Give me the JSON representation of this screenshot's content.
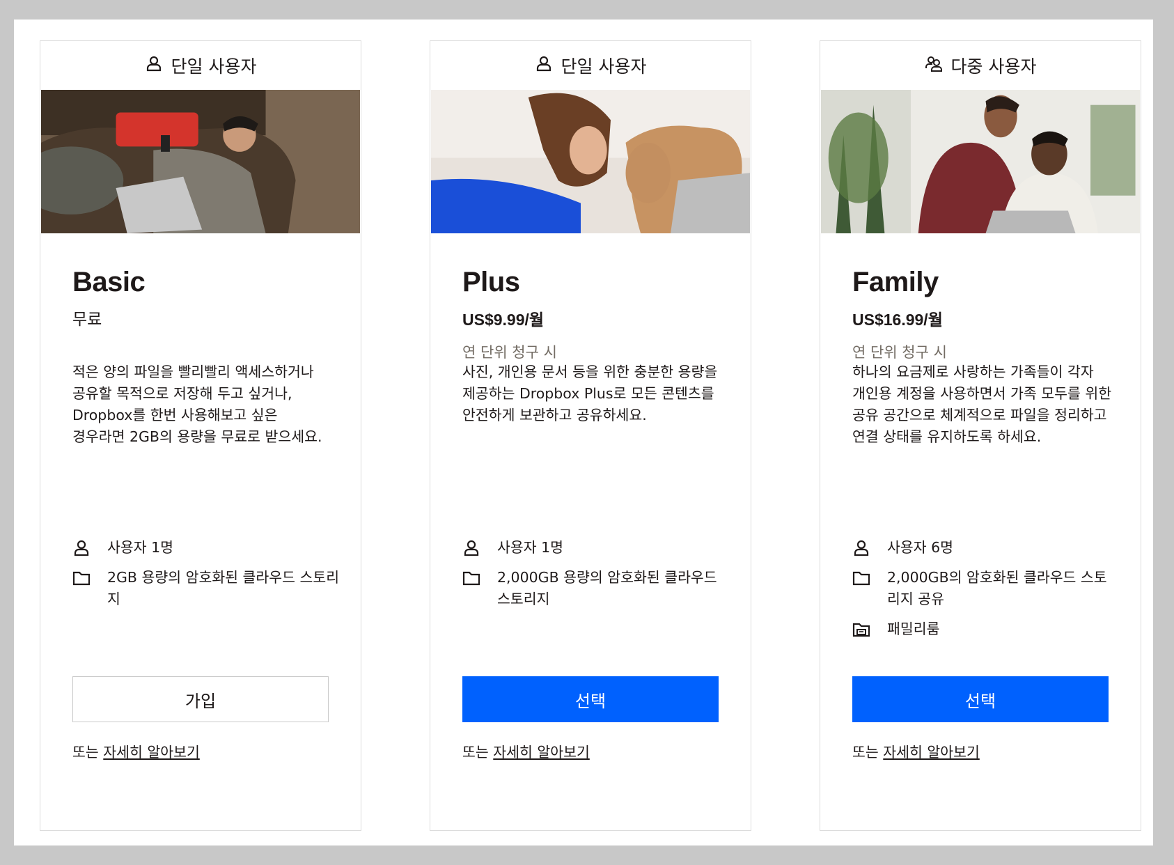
{
  "cards": [
    {
      "audience": "단일 사용자",
      "audience_icon": "single-user-icon",
      "name": "Basic",
      "price": "무료",
      "billing": "",
      "description": "적은 양의 파일을 빨리빨리 액세스하거나 공유할 목적으로 저장해 두고 싶거나, Dropbox를 한번 사용해보고 싶은 경우라면 2GB의 용량을 무료로 받으세요.",
      "features": [
        {
          "icon": "user-icon",
          "text": "사용자 1명"
        },
        {
          "icon": "folder-icon",
          "text": "2GB 용량의 암호화된 클라우드 스토리지"
        }
      ],
      "button": "가입",
      "or_text": "또는",
      "learn_more": "자세히 알아보기"
    },
    {
      "audience": "단일 사용자",
      "audience_icon": "single-user-icon",
      "name": "Plus",
      "price": "US$9.99/월",
      "billing": "연 단위 청구 시",
      "description": "사진, 개인용 문서 등을 위한 충분한 용량을 제공하는 Dropbox Plus로 모든 콘텐츠를 안전하게 보관하고 공유하세요.",
      "features": [
        {
          "icon": "user-icon",
          "text": "사용자 1명"
        },
        {
          "icon": "folder-icon",
          "text": "2,000GB 용량의 암호화된 클라우드 스토리지"
        }
      ],
      "button": "선택",
      "or_text": "또는",
      "learn_more": "자세히 알아보기"
    },
    {
      "audience": "다중 사용자",
      "audience_icon": "multi-user-icon",
      "name": "Family",
      "price": "US$16.99/월",
      "billing": "연 단위 청구 시",
      "description": "하나의 요금제로 사랑하는 가족들이 각자 개인용 계정을 사용하면서 가족 모두를 위한 공유 공간으로 체계적으로 파일을 정리하고 연결 상태를 유지하도록 하세요.",
      "features": [
        {
          "icon": "user-icon",
          "text": "사용자 6명"
        },
        {
          "icon": "folder-icon",
          "text": "2,000GB의 암호화된 클라우드 스토리지 공유"
        },
        {
          "icon": "family-room-icon",
          "text": "패밀리룸"
        }
      ],
      "button": "선택",
      "or_text": "또는",
      "learn_more": "자세히 알아보기"
    }
  ],
  "colors": {
    "primary_button": "#0061fe",
    "muted_text": "#736c64",
    "border": "#dcdcdc"
  }
}
